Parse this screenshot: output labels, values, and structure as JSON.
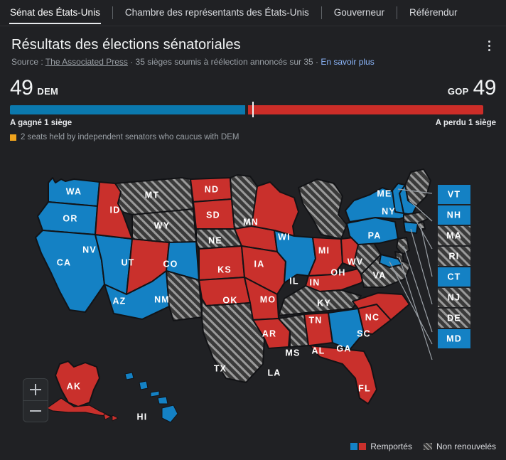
{
  "tabs": [
    {
      "label": "Sénat des États-Unis",
      "active": true
    },
    {
      "label": "Chambre des représentants des États-Unis",
      "active": false
    },
    {
      "label": "Gouverneur",
      "active": false
    },
    {
      "label": "Référendur",
      "active": false
    }
  ],
  "header": {
    "title": "Résultats des élections sénatoriales",
    "source_prefix": "Source : ",
    "source_name": "The Associated Press",
    "source_mid": " · 35 sièges soumis à réélection annoncés sur 35 · ",
    "more_link": "En savoir plus",
    "menu_icon": "kebab-menu-icon"
  },
  "tally": {
    "dem_count": "49",
    "dem_label": "DEM",
    "gop_label": "GOP",
    "gop_count": "49",
    "dem_note": "A gagné 1 siège",
    "gop_note": "A perdu 1 siège",
    "independent_note": "2 seats held by independent senators who caucus with DEM",
    "dem_color": "#0b79ae",
    "gop_color": "#cc2d28",
    "independent_color": "#efa31d",
    "dem_bar_pct": 48.4,
    "gop_bar_pct": 48.4
  },
  "map": {
    "zoom_in_label": "+",
    "zoom_out_label": "−",
    "colors": {
      "dem": "#1481c4",
      "gop": "#c9302c",
      "not_up": "#3a3a3a",
      "hatch_stroke": "#9a9a9a",
      "border": "#121316"
    },
    "legend": [
      {
        "label": "Remportés",
        "swatch": "blue-red-pair"
      },
      {
        "label": "Non renouvelés",
        "swatch": "hatched"
      }
    ],
    "states": [
      {
        "code": "WA",
        "result": "dem"
      },
      {
        "code": "OR",
        "result": "dem"
      },
      {
        "code": "CA",
        "result": "dem"
      },
      {
        "code": "NV",
        "result": "dem"
      },
      {
        "code": "ID",
        "result": "gop"
      },
      {
        "code": "UT",
        "result": "gop"
      },
      {
        "code": "AZ",
        "result": "dem"
      },
      {
        "code": "MT",
        "result": "not_up"
      },
      {
        "code": "WY",
        "result": "not_up"
      },
      {
        "code": "CO",
        "result": "dem"
      },
      {
        "code": "NM",
        "result": "not_up"
      },
      {
        "code": "ND",
        "result": "gop"
      },
      {
        "code": "SD",
        "result": "gop"
      },
      {
        "code": "NE",
        "result": "not_up"
      },
      {
        "code": "KS",
        "result": "gop"
      },
      {
        "code": "OK",
        "result": "gop"
      },
      {
        "code": "TX",
        "result": "not_up"
      },
      {
        "code": "MN",
        "result": "not_up"
      },
      {
        "code": "IA",
        "result": "gop"
      },
      {
        "code": "MO",
        "result": "gop"
      },
      {
        "code": "AR",
        "result": "gop"
      },
      {
        "code": "LA",
        "result": "gop"
      },
      {
        "code": "WI",
        "result": "gop"
      },
      {
        "code": "IL",
        "result": "dem"
      },
      {
        "code": "MI",
        "result": "not_up"
      },
      {
        "code": "IN",
        "result": "gop"
      },
      {
        "code": "OH",
        "result": "gop"
      },
      {
        "code": "KY",
        "result": "gop"
      },
      {
        "code": "TN",
        "result": "not_up"
      },
      {
        "code": "MS",
        "result": "not_up"
      },
      {
        "code": "AL",
        "result": "gop"
      },
      {
        "code": "GA",
        "result": "dem"
      },
      {
        "code": "FL",
        "result": "gop"
      },
      {
        "code": "SC",
        "result": "gop"
      },
      {
        "code": "NC",
        "result": "gop"
      },
      {
        "code": "WV",
        "result": "not_up"
      },
      {
        "code": "VA",
        "result": "not_up"
      },
      {
        "code": "PA",
        "result": "dem"
      },
      {
        "code": "NY",
        "result": "dem"
      },
      {
        "code": "ME",
        "result": "not_up"
      },
      {
        "code": "AK",
        "result": "gop"
      },
      {
        "code": "HI",
        "result": "dem"
      }
    ],
    "callout_boxes": [
      {
        "code": "VT",
        "result": "dem"
      },
      {
        "code": "NH",
        "result": "dem"
      },
      {
        "code": "MA",
        "result": "not_up"
      },
      {
        "code": "RI",
        "result": "not_up"
      },
      {
        "code": "CT",
        "result": "dem"
      },
      {
        "code": "NJ",
        "result": "not_up"
      },
      {
        "code": "DE",
        "result": "not_up"
      },
      {
        "code": "MD",
        "result": "dem"
      }
    ]
  }
}
